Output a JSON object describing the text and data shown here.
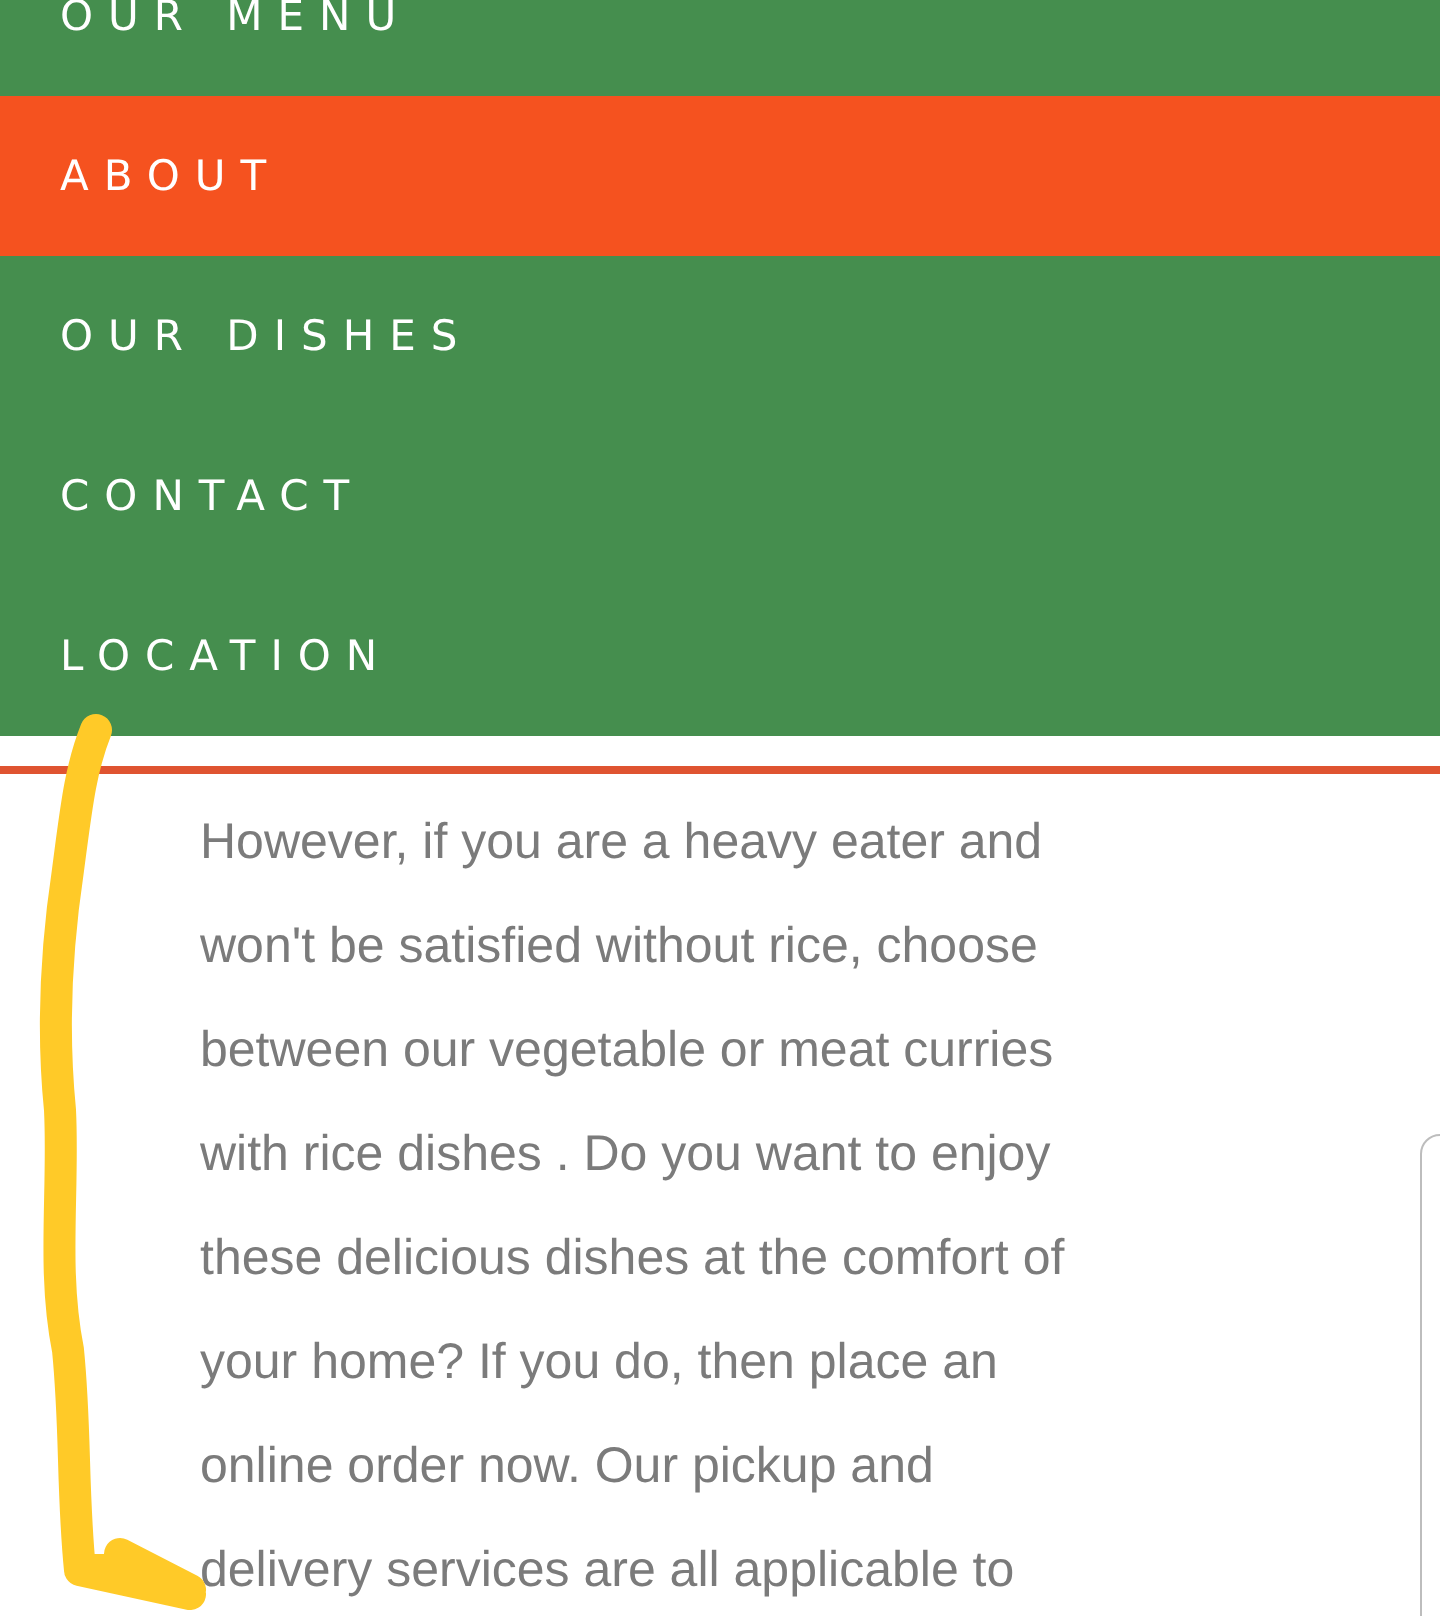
{
  "nav": {
    "items": [
      {
        "label": "OUR MENU",
        "selected": false
      },
      {
        "label": "ABOUT",
        "selected": true
      },
      {
        "label": "OUR DISHES",
        "selected": false
      },
      {
        "label": "CONTACT",
        "selected": false
      },
      {
        "label": "LOCATION",
        "selected": false
      }
    ]
  },
  "content": {
    "paragraph_lines": [
      "However, if you are a heavy eater and",
      "won't be satisfied without rice, choose",
      "between our vegetable or meat curries",
      "with rice dishes . Do you want to enjoy",
      "these delicious dishes at the comfort of",
      "your home? If you do, then place an",
      "online order now. Our pickup and",
      "delivery services are all applicable to"
    ]
  }
}
